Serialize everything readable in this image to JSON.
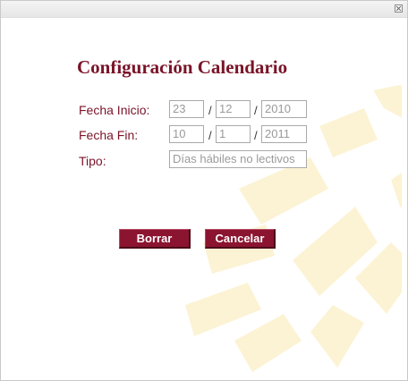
{
  "dialog": {
    "title": "Configuración Calendario"
  },
  "form": {
    "fecha_inicio": {
      "label": "Fecha Inicio:",
      "day": "23",
      "month": "12",
      "year": "2010"
    },
    "fecha_fin": {
      "label": "Fecha Fin:",
      "day": "10",
      "month": "1",
      "year": "2011"
    },
    "tipo": {
      "label": "Tipo:",
      "value": "Días hábiles no lectivos"
    },
    "separator": "/"
  },
  "buttons": {
    "borrar": "Borrar",
    "cancelar": "Cancelar"
  },
  "colors": {
    "accent": "#7a1428",
    "button": "#8b1430",
    "watermark": "#fcf3d4"
  },
  "icons": {
    "close": "close-icon",
    "watermark": "sunburst-watermark"
  }
}
